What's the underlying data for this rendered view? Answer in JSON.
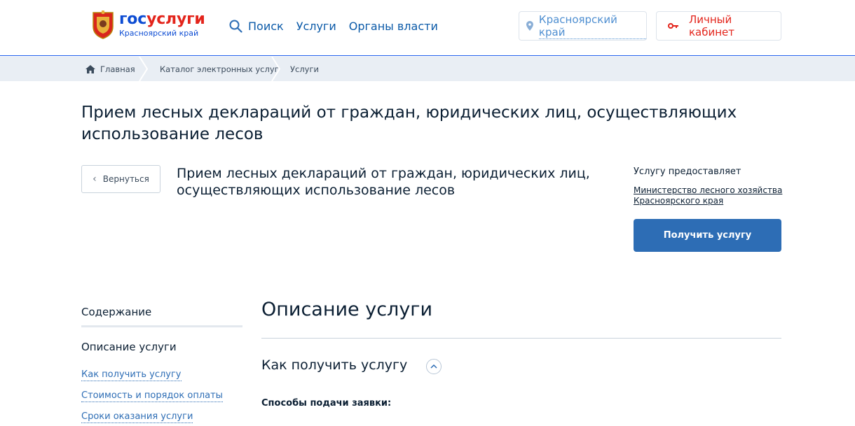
{
  "header": {
    "brand_part1": "гос",
    "brand_part2": "услуги",
    "region_subtitle": "Красноярский край",
    "search_label": "Поиск",
    "nav": [
      "Услуги",
      "Органы власти"
    ],
    "region_button": "Красноярский край",
    "account_button": "Личный кабинет"
  },
  "breadcrumbs": [
    "Главная",
    "Каталог электронных услуг",
    "Услуги"
  ],
  "page": {
    "title": "Прием лесных деклараций от граждан, юридических лиц, осуществляющих использование лесов",
    "back_label": "Вернуться",
    "service_name": "Прием лесных деклараций от граждан, юридических лиц, осуществляющих использование лесов",
    "provider_label": "Услугу предоставляет",
    "provider_name": "Министерство лесного хозяйства Красноярского края",
    "get_service_button": "Получить услугу"
  },
  "toc": {
    "heading": "Содержание",
    "active": "Описание услуги",
    "links": [
      "Как получить услугу",
      "Стоимость и порядок оплаты",
      "Сроки оказания услуги"
    ]
  },
  "content": {
    "title": "Описание услуги",
    "section_title": "Как получить услугу",
    "methods_label": "Способы подачи заявки:"
  },
  "colors": {
    "brand_blue": "#0d4cd3",
    "brand_red": "#e3241b",
    "button_blue": "#2d6db5",
    "breadcrumb_bg": "#e9eef4"
  },
  "icons": [
    "coat-of-arms-icon",
    "search-icon",
    "location-pin-icon",
    "key-icon",
    "home-icon",
    "chevron-left-icon",
    "chevron-up-icon"
  ]
}
